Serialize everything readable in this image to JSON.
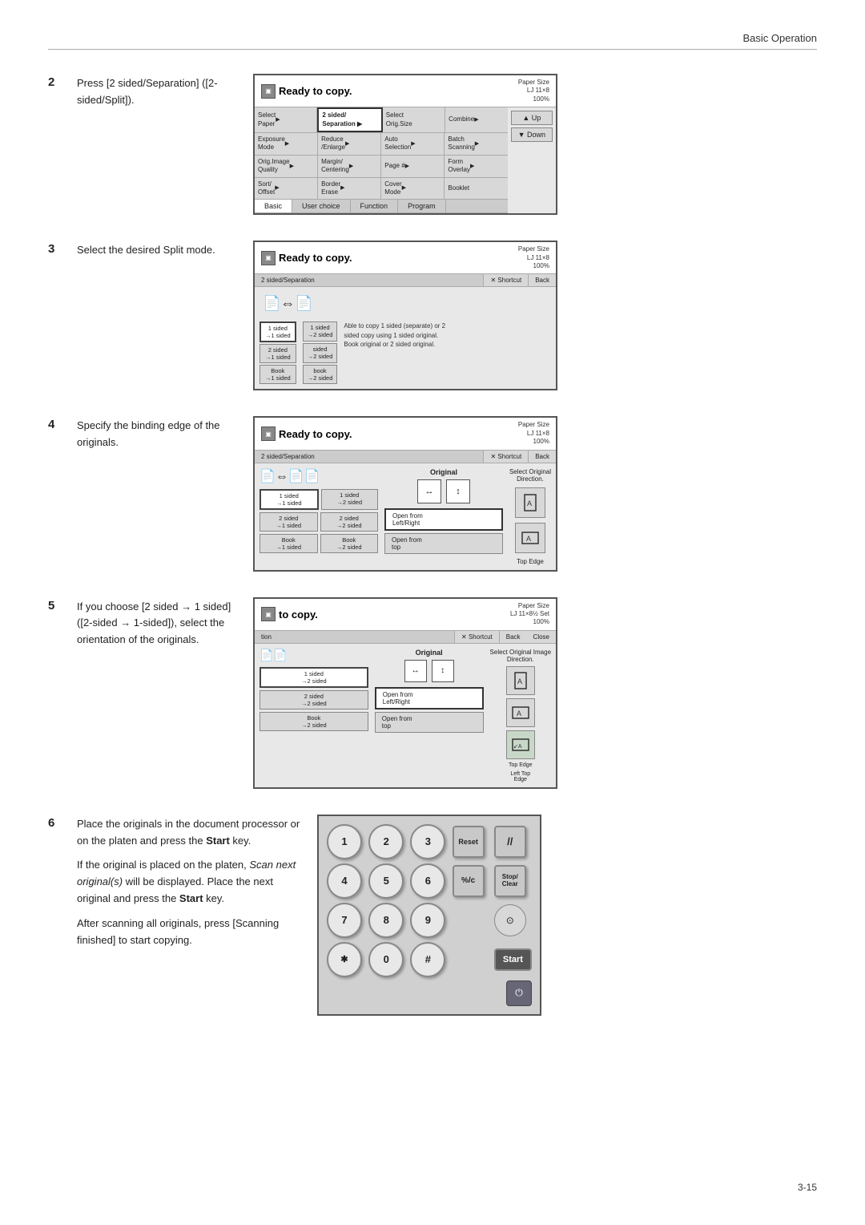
{
  "header": {
    "title": "Basic Operation"
  },
  "footer": {
    "page": "3-15"
  },
  "steps": [
    {
      "num": "2",
      "text": "Press [2 sided/Separation] ([2-sided/Split]).",
      "screen": "screen1"
    },
    {
      "num": "3",
      "text": "Select the desired Split mode.",
      "screen": "screen2"
    },
    {
      "num": "4",
      "text": "Specify the binding edge of the originals.",
      "screen": "screen3"
    },
    {
      "num": "5",
      "text": "If you choose [2 sided → 1 sided] ([2-sided → 1-sided]), select the orientation of the originals.",
      "screen": "screen4"
    },
    {
      "num": "6",
      "text_parts": [
        "Place the originals in the document processor or on the platen and press the Start key.",
        "If the original is placed on the platen, Scan next original(s) will be displayed. Place the next original and press the Start key.",
        "After scanning all originals, press [Scanning finished] to start copying."
      ],
      "screen": "keypad"
    }
  ],
  "screen1": {
    "ready": "Ready to copy.",
    "paper_size": "Paper Size",
    "paper_dim": "LJ 11×8",
    "percent": "100%",
    "rows": [
      [
        {
          "text": "Select\nPaper",
          "arrow": true
        },
        {
          "text": "2 sided/\nSeparation",
          "arrow": true,
          "highlight": true
        },
        {
          "text": "Select\nOrig.Size",
          "arrow": false
        },
        {
          "text": "Combine",
          "arrow": true
        }
      ],
      [
        {
          "text": "Exposure\nMode",
          "arrow": true
        },
        {
          "text": "Reduce\n/Enlarge",
          "arrow": true
        },
        {
          "text": "Auto\nSelection",
          "arrow": true
        },
        {
          "text": "Batch\nScanning",
          "arrow": true
        }
      ],
      [
        {
          "text": "Orig.Image\nQuality",
          "arrow": true
        },
        {
          "text": "Margin/\nCentering",
          "arrow": true
        },
        {
          "text": "Page #",
          "arrow": true
        },
        {
          "text": "Form\nOverlay",
          "arrow": true
        }
      ],
      [
        {
          "text": "Sort/\nOffset",
          "arrow": true
        },
        {
          "text": "Border\nErase",
          "arrow": true
        },
        {
          "text": "Cover\nMode",
          "arrow": true
        },
        {
          "text": "Booklet",
          "arrow": false
        }
      ]
    ],
    "tabs": [
      "Basic",
      "User choice",
      "Function",
      "Program"
    ],
    "side_btns": [
      "▲ Up",
      "▼ Down"
    ]
  },
  "screen2": {
    "ready": "Ready to copy.",
    "paper_size": "Paper Size",
    "paper_dim": "LJ 11×8",
    "percent": "100%",
    "header_label": "2 sided/Separation",
    "shortcut": "✕ Shortcut",
    "back": "Back",
    "options_left": [
      {
        "text": "1 sided\n→1 sided",
        "selected": true
      },
      {
        "text": "2 sided\n→1 sided",
        "selected": false
      },
      {
        "text": "Book\n→1 sided",
        "selected": false
      }
    ],
    "options_right": [
      {
        "text": "1 sided\n→2 sided",
        "selected": false
      },
      {
        "text": "sided\n→2 sided",
        "selected": false
      },
      {
        "text": "book\n→2 sided",
        "selected": false
      }
    ],
    "note": "Able to copy 1 sided (separate) or 2 sided copy using 1 sided original.\nBook original or 2 sided original."
  },
  "screen3": {
    "ready": "Ready to copy.",
    "paper_size": "Paper Size",
    "paper_dim": "LJ 11×8",
    "percent": "100%",
    "header_label": "2 sided/Separation",
    "shortcut": "✕ Shortcut",
    "back": "Back",
    "original_label": "Original",
    "select_label": "Select Original Direction.",
    "open_options": [
      {
        "text": "Open from\nLeft/Right",
        "selected": true
      },
      {
        "text": "Open from\ntop",
        "selected": false
      }
    ],
    "edge_label": "Top Edge",
    "sides": [
      [
        "1 sided\n→1 sided",
        "1 sided\n→2 sided"
      ],
      [
        "2 sided\n→1 sided",
        "2 sided\n→2 sided"
      ],
      [
        "Book\n→1 sided",
        "Book\n→2 sided"
      ]
    ]
  },
  "screen4": {
    "ready": "to copy.",
    "paper_size": "Paper Size",
    "paper_dim": "LJ 11×8½",
    "percent": "100%",
    "set_label": "Set",
    "header_label": "tion",
    "shortcut": "✕ Shortcut",
    "back": "Back",
    "close": "Close",
    "original_label": "Original",
    "select_label": "Select Original Image Direction.",
    "open_options": [
      {
        "text": "Open from\nLeft/Right",
        "selected": true
      },
      {
        "text": "Open from\ntop",
        "selected": false
      }
    ],
    "edge_label": "Top Edge",
    "left_top_label": "Left Top\nEdge",
    "sides": [
      [
        "1 sided\n→2 sided"
      ],
      [
        "2 sided\n→2 sided"
      ],
      [
        "Book\n→2 sided"
      ]
    ]
  },
  "keypad": {
    "keys": [
      [
        "1",
        "2",
        "3",
        "Reset",
        "//"
      ],
      [
        "4",
        "5",
        "6",
        "%/c",
        "Stop/\nClear"
      ],
      [
        "7",
        "8",
        "9",
        "",
        ""
      ],
      [
        "✱",
        "0",
        "#",
        "",
        "Start"
      ]
    ]
  },
  "step6_texts": {
    "line1": "Place the originals in the document processor or on the platen and press the ",
    "line1_bold": "Start",
    "line1_end": " key.",
    "line2_pre": "If the original is placed on the platen, ",
    "line2_italic": "Scan next original(s)",
    "line2_mid": " will be displayed. Place the next original and press the ",
    "line2_bold": "Start",
    "line2_end": " key.",
    "line3": "After scanning all originals, press [Scanning finished] to start copying."
  }
}
